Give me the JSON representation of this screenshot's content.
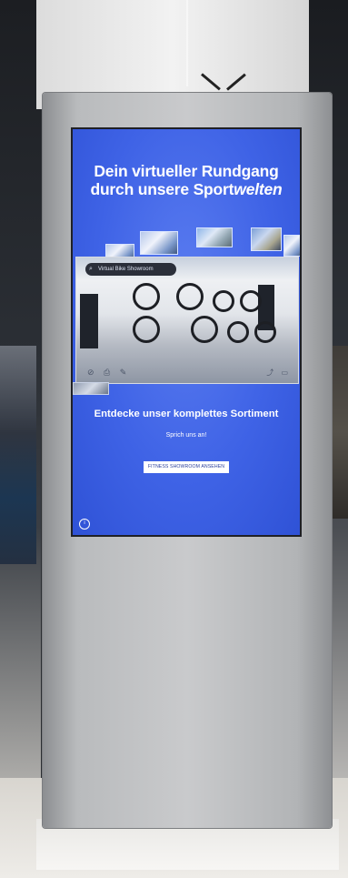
{
  "screen": {
    "headline_line1": "Dein virtueller Rundgang",
    "headline_line2_a": "durch unsere Sport",
    "headline_line2_b": "welten",
    "tour": {
      "search_text": "Virtual Bike Showroom"
    },
    "subheadline": "Entdecke unser komplettes Sortiment",
    "callout": "Sprich uns an!",
    "cta_label": "FITNESS SHOWROOM ANSEHEN"
  },
  "icons": {
    "help": "info-icon",
    "search": "search-icon"
  },
  "colors": {
    "screen_blue": "#3f63e6",
    "kiosk_silver": "#c9cacc"
  }
}
